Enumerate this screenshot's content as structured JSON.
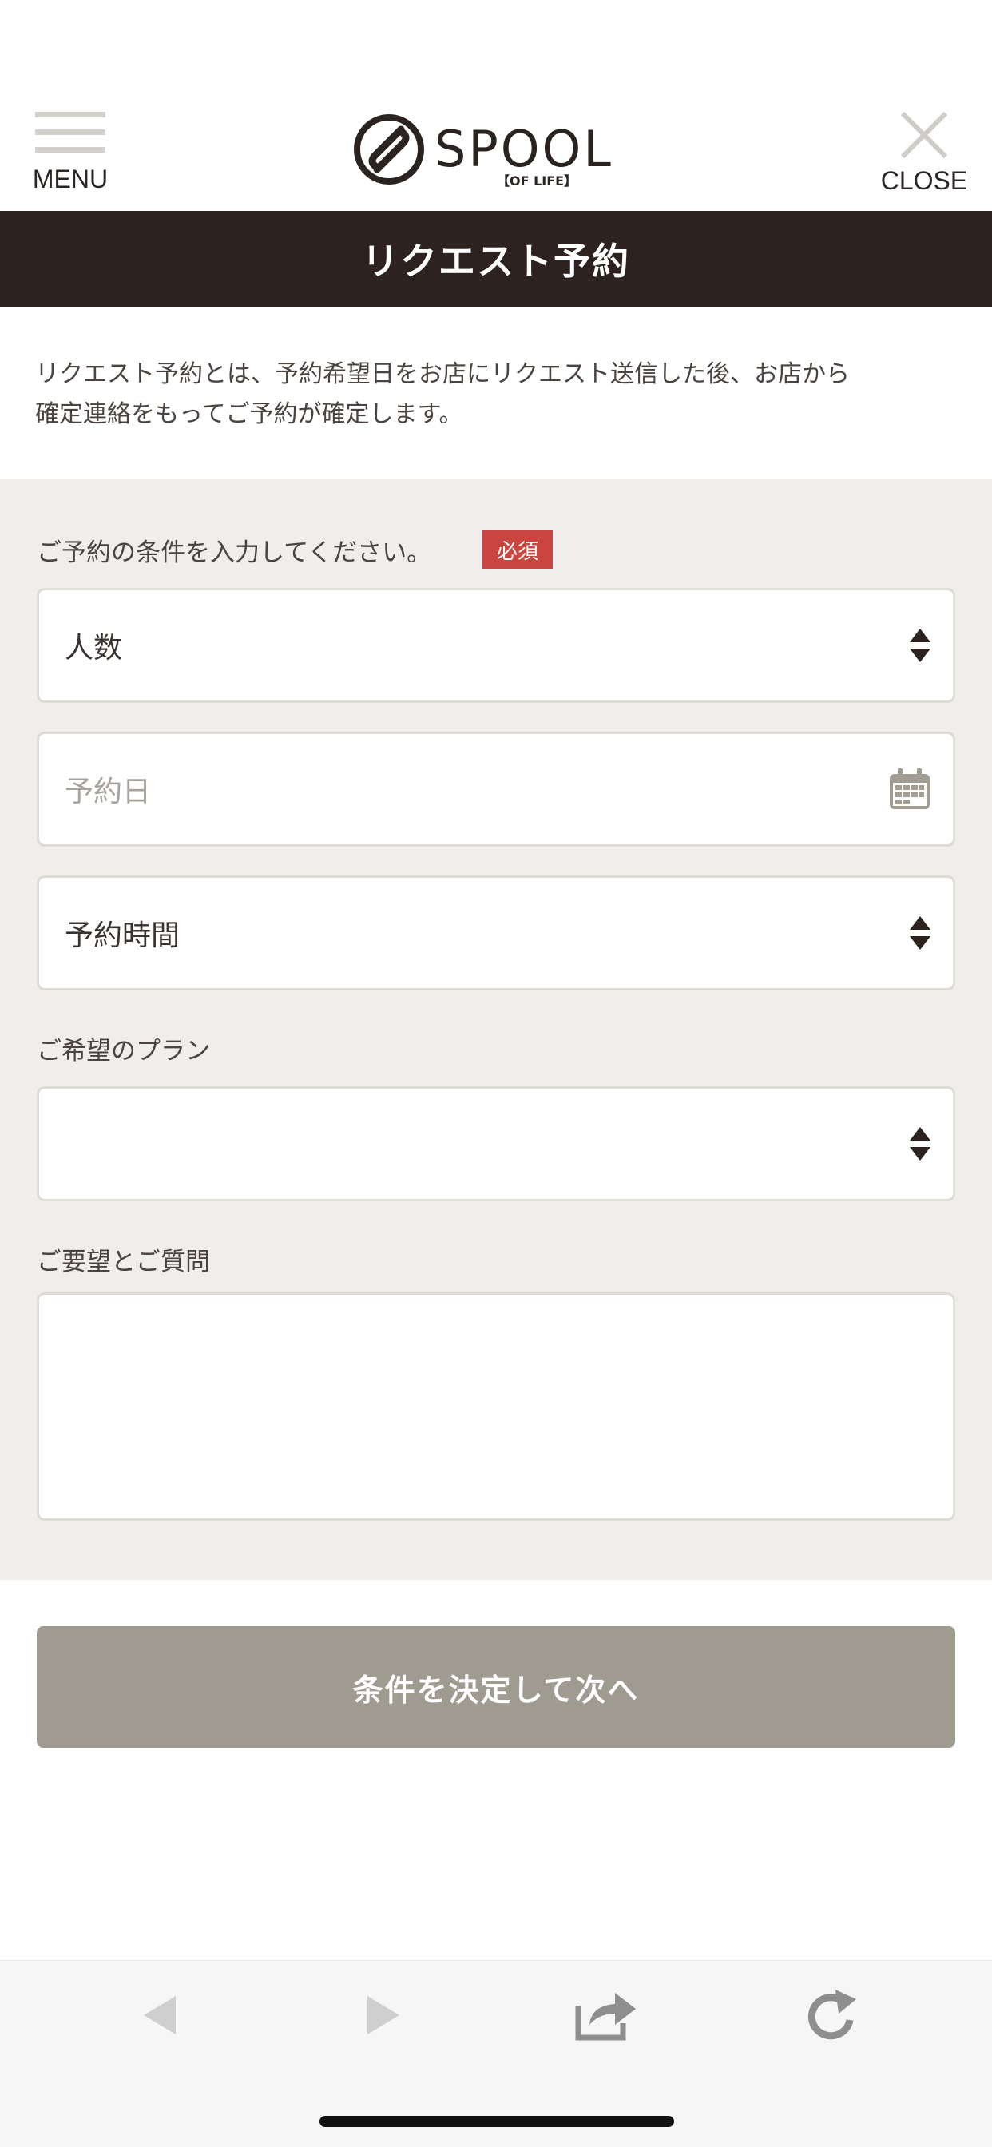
{
  "header": {
    "menu_label": "MENU",
    "close_label": "CLOSE",
    "logo_text": "SPOOL",
    "logo_subtext": "【OF LIFE】"
  },
  "page_title": "リクエスト予約",
  "intro": {
    "line1": "リクエスト予約とは、予約希望日をお店にリクエスト送信した後、お店から",
    "line2": "確定連絡をもってご予約が確定します。"
  },
  "form": {
    "conditions_label": "ご予約の条件を入力してください。",
    "required_badge": "必須",
    "people_select": "人数",
    "date_placeholder": "予約日",
    "time_select": "予約時間",
    "plan_label": "ご希望のプラン",
    "plan_select": "",
    "requests_label": "ご要望とご質問",
    "requests_value": ""
  },
  "submit_label": "条件を決定して次へ",
  "colors": {
    "title_bar": "#2e2220",
    "required": "#c94640",
    "button": "#a09b91",
    "form_bg": "#f0eeea"
  },
  "toolbar_icons": [
    "back-arrow-icon",
    "forward-arrow-icon",
    "share-icon",
    "reload-icon"
  ]
}
